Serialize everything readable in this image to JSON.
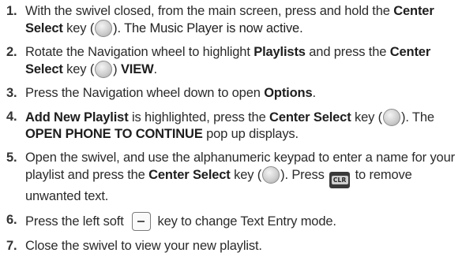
{
  "steps": [
    {
      "num": "1.",
      "t1": "With the swivel closed, from the main screen, press and hold the ",
      "b1": "Center Select",
      "t2": " key (",
      "icon1": "center-select-key-icon",
      "t3": "). The Music Player is now active."
    },
    {
      "num": "2.",
      "t1": "Rotate the Navigation wheel to highlight ",
      "b1": "Playlists",
      "t2": " and press the ",
      "b2": "Center Select",
      "t3": " key (",
      "icon1": "center-select-key-icon",
      "t4": ") ",
      "b3": "VIEW",
      "t5": "."
    },
    {
      "num": "3.",
      "t1": "Press the Navigation wheel down to open ",
      "b1": "Options",
      "t2": "."
    },
    {
      "num": "4.",
      "b1": "Add New Playlist",
      "t1": " is highlighted, press the ",
      "b2": "Center Select",
      "t2": " key (",
      "icon1": "center-select-key-icon",
      "t3": "). The ",
      "b3": "OPEN PHONE TO CONTINUE",
      "t4": " pop up displays."
    },
    {
      "num": "5.",
      "t1": "Open the swivel, and use the alphanumeric keypad to enter a name for your playlist and press the ",
      "b1": "Center Select",
      "t2": " key (",
      "icon1": "center-select-key-icon",
      "t3": "). Press ",
      "clr_label": "CLR",
      "icon2": "clr-key-icon",
      "t4": " to remove unwanted text."
    },
    {
      "num": "6.",
      "t1": "Press the left soft ",
      "icon1": "left-soft-key-icon",
      "t2": " key to change Text Entry mode."
    },
    {
      "num": "7.",
      "t1": "Close the swivel to view your new playlist."
    }
  ]
}
